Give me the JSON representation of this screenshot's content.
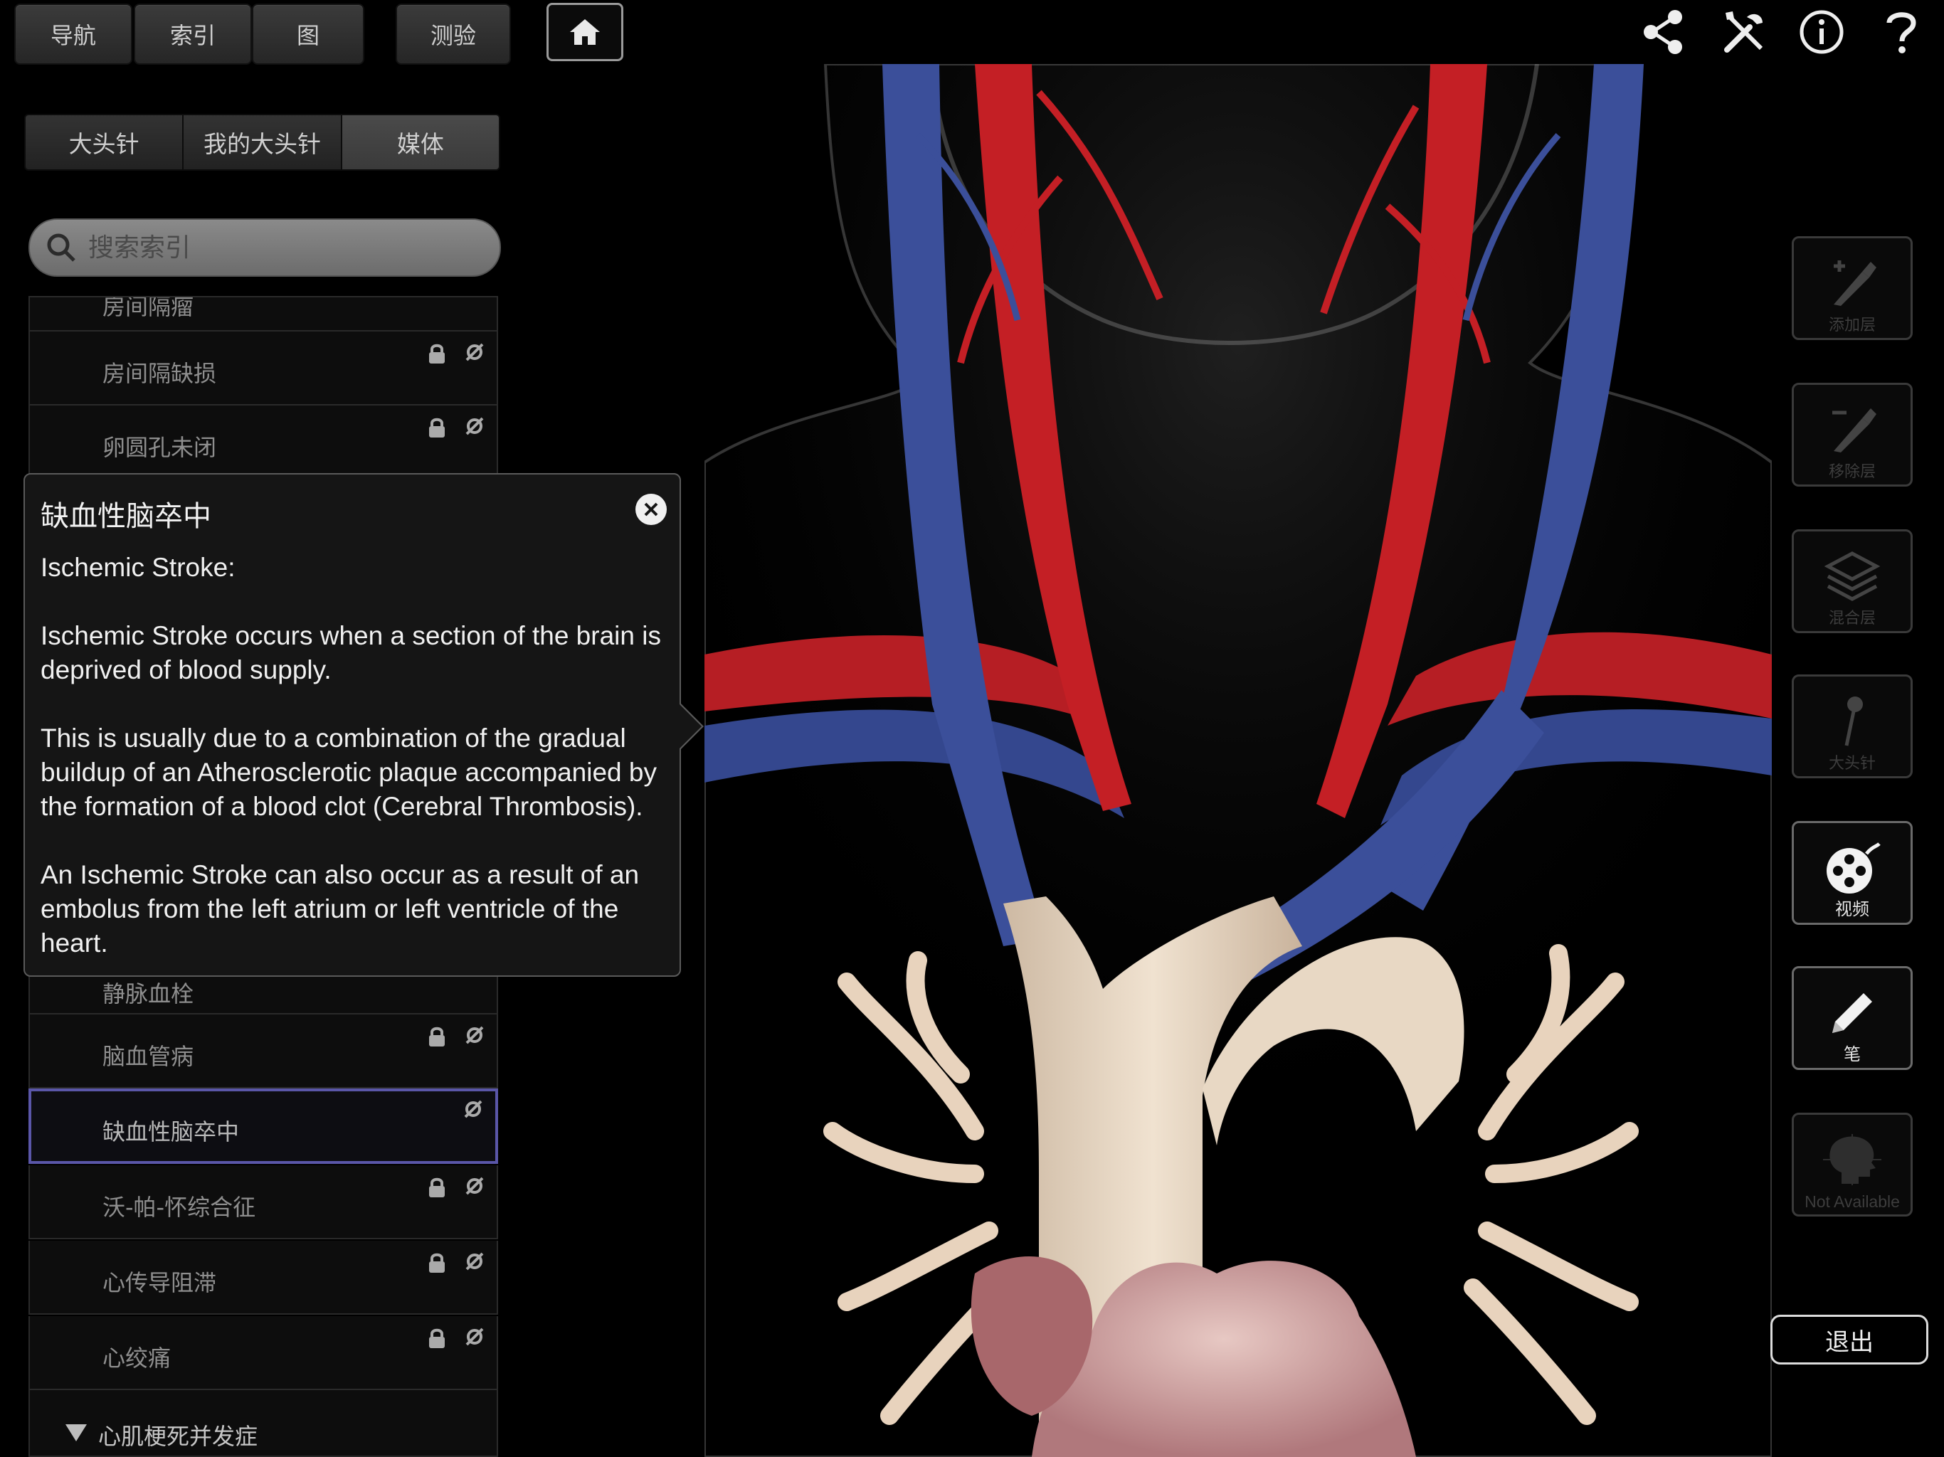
{
  "top_tabs": {
    "nav": "导航",
    "index": "索引",
    "graph": "图",
    "quiz": "测验"
  },
  "segmented": {
    "pins": "大头针",
    "my_pins": "我的大头针",
    "media": "媒体"
  },
  "search": {
    "placeholder": "搜索索引"
  },
  "list": {
    "partial_top": "房间隔瘤",
    "rows": [
      {
        "label": "房间隔缺损",
        "locked": true
      },
      {
        "label": "卵圆孔未闭",
        "locked": true
      },
      {
        "label": "静脉血栓",
        "locked": true
      },
      {
        "label": "脑血管病",
        "locked": true
      },
      {
        "label": "缺血性脑卒中",
        "locked": false,
        "selected": true
      },
      {
        "label": "沃-帕-怀综合征",
        "locked": true
      },
      {
        "label": "心传导阻滞",
        "locked": true
      },
      {
        "label": "心绞痛",
        "locked": true
      }
    ],
    "group_header": "心肌梗死并发症"
  },
  "popover": {
    "title": "缺血性脑卒中",
    "heading": "Ischemic Stroke:",
    "p1": "Ischemic Stroke occurs when a section of the brain is deprived of blood supply.",
    "p2": "This is usually due to a combination of the gradual buildup of an Atherosclerotic plaque accompanied by the formation of a blood clot (Cerebral Thrombosis).",
    "p3": "An Ischemic Stroke can also occur as a result of an embolus from the left atrium or left ventricle of the heart."
  },
  "tools": {
    "add_layer": "添加层",
    "remove_layer": "移除层",
    "blend_layer": "混合层",
    "pin": "大头针",
    "video": "视频",
    "pen": "笔",
    "not_available": "Not Available"
  },
  "exit_label": "退出",
  "colors": {
    "artery": "#c41f25",
    "vein": "#3b4f9a",
    "vessel_pale": "#e8d3bd",
    "accent_selected": "#5a56a8"
  },
  "icons": [
    "home-icon",
    "share-icon",
    "tools-icon",
    "info-icon",
    "help-icon",
    "search-icon",
    "lock-icon",
    "pin-hide-icon",
    "close-icon",
    "scalpel-plus-icon",
    "scalpel-minus-icon",
    "layers-icon",
    "pin-icon",
    "film-reel-icon",
    "pencil-icon",
    "head-profile-icon"
  ]
}
